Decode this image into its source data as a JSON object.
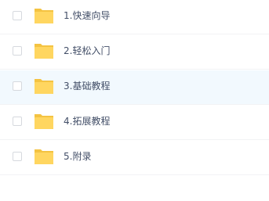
{
  "files": [
    {
      "name": "1.快速向导",
      "icon": "folder-icon"
    },
    {
      "name": "2.轻松入门",
      "icon": "folder-icon"
    },
    {
      "name": "3.基础教程",
      "icon": "folder-icon"
    },
    {
      "name": "4.拓展教程",
      "icon": "folder-icon"
    },
    {
      "name": "5.附录",
      "icon": "folder-icon"
    }
  ],
  "colors": {
    "folder_back": "#f4c342",
    "folder_front": "#ffd660",
    "hover_row": "#f2f9fe",
    "text": "#424e67"
  }
}
